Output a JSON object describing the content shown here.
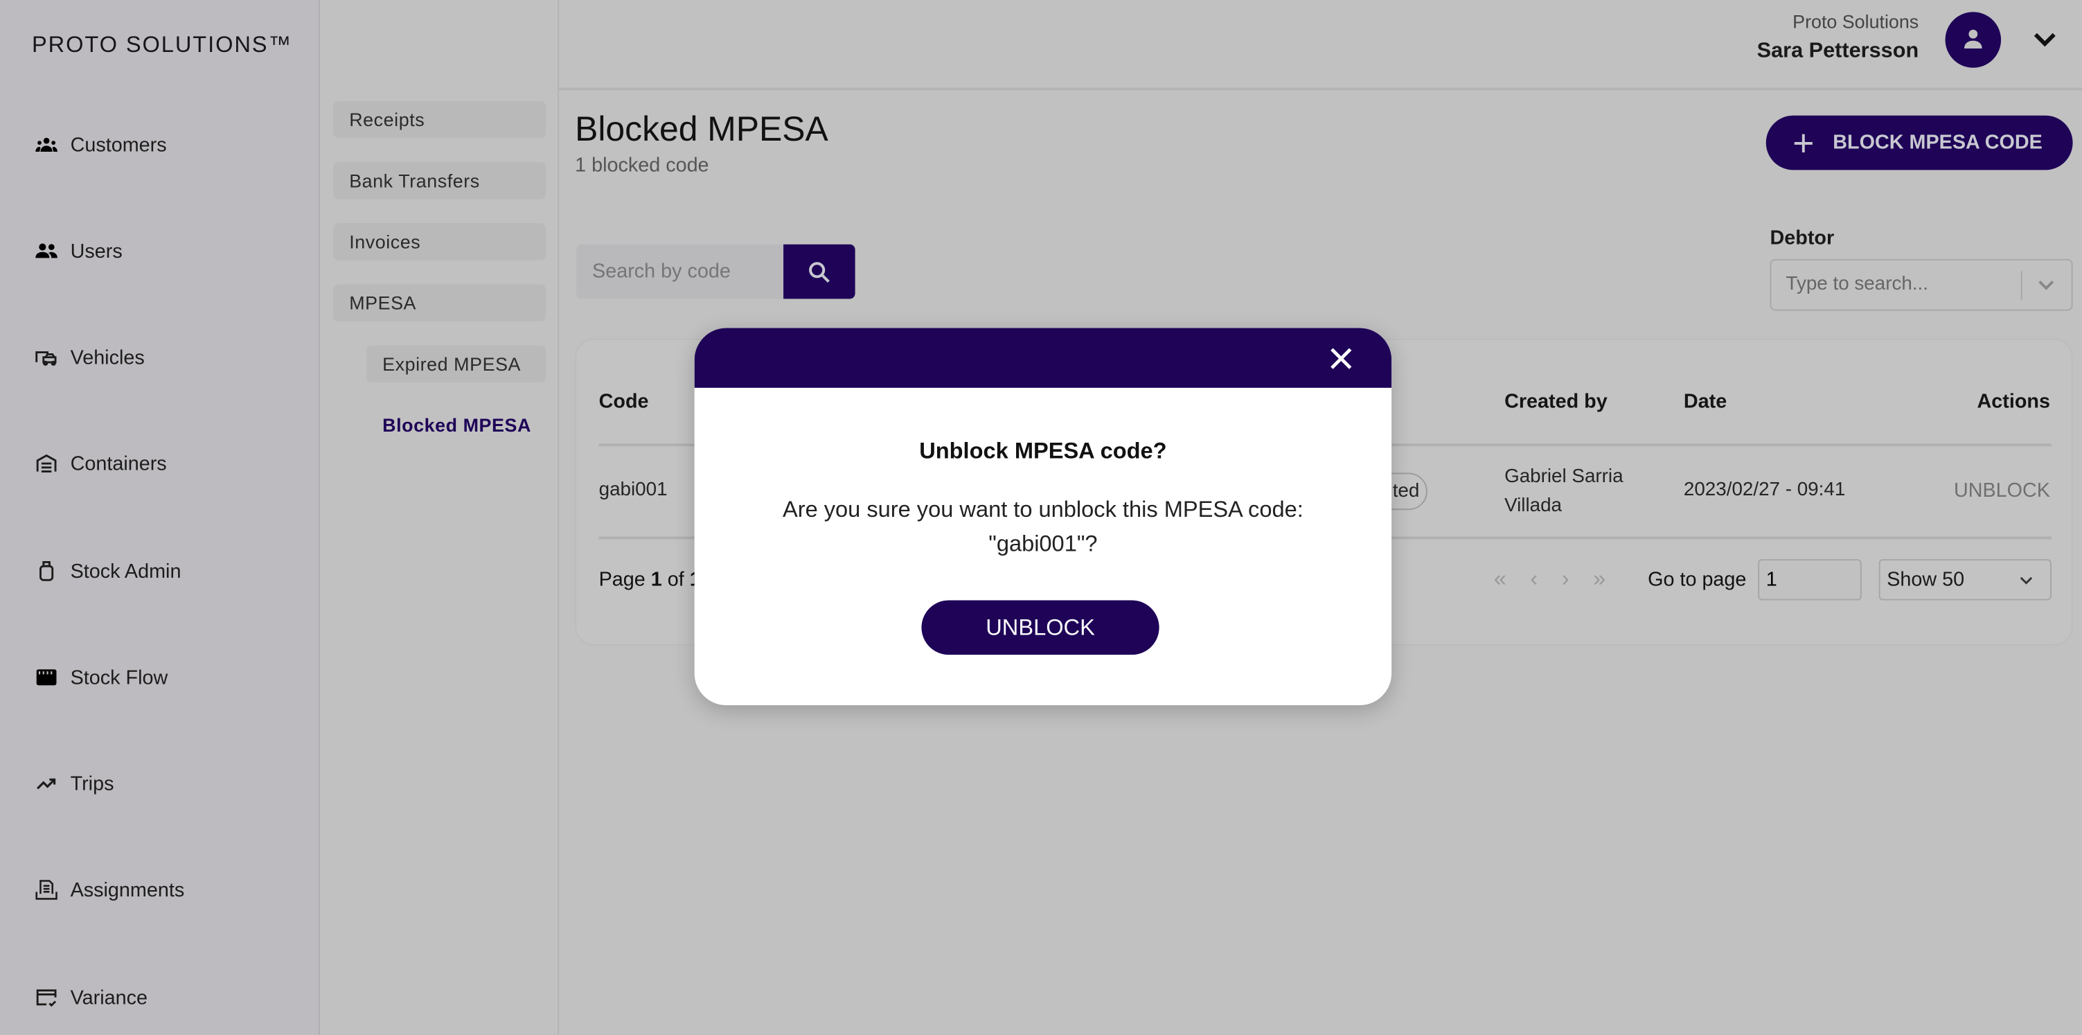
{
  "brand": "PROTO SOLUTIONS™",
  "sidebar": {
    "items": [
      {
        "label": "Customers",
        "icon": "customers-icon"
      },
      {
        "label": "Users",
        "icon": "users-icon"
      },
      {
        "label": "Vehicles",
        "icon": "vehicles-icon"
      },
      {
        "label": "Containers",
        "icon": "warehouse-icon"
      },
      {
        "label": "Stock Admin",
        "icon": "cylinder-icon"
      },
      {
        "label": "Stock Flow",
        "icon": "store-icon"
      },
      {
        "label": "Trips",
        "icon": "trending-up-icon"
      },
      {
        "label": "Assignments",
        "icon": "document-tray-icon"
      },
      {
        "label": "Variance",
        "icon": "card-check-icon"
      }
    ]
  },
  "submenu": {
    "items": [
      "Receipts",
      "Bank Transfers",
      "Invoices",
      "MPESA"
    ],
    "children": [
      "Expired MPESA",
      "Blocked MPESA"
    ],
    "active": "Blocked MPESA"
  },
  "header": {
    "org": "Proto Solutions",
    "user": "Sara Pettersson"
  },
  "page": {
    "title": "Blocked MPESA",
    "subtitle": "1 blocked code",
    "block_button": "BLOCK MPESA CODE"
  },
  "search": {
    "placeholder": "Search by code",
    "value": ""
  },
  "filter": {
    "label": "Debtor",
    "placeholder": "Type to search..."
  },
  "table": {
    "columns": [
      "Code",
      "Created by",
      "Date",
      "Actions"
    ],
    "rows": [
      {
        "code": "gabi001",
        "status_partial": "ted",
        "created_by": "Gabriel Sarria Villada",
        "date": "2023/02/27 - 09:41",
        "action": "UNBLOCK"
      }
    ]
  },
  "pagination": {
    "page_prefix": "Page",
    "page": "1",
    "of": "of",
    "total": "1",
    "goto_label": "Go to page",
    "goto_value": "1",
    "page_size": "Show 50"
  },
  "modal": {
    "title": "Unblock MPESA code?",
    "message": "Are you sure you want to unblock this MPESA code: \"gabi001\"?",
    "confirm": "UNBLOCK"
  },
  "colors": {
    "brand": "#1e0357",
    "overlay_dim": "#c0c0c0"
  }
}
